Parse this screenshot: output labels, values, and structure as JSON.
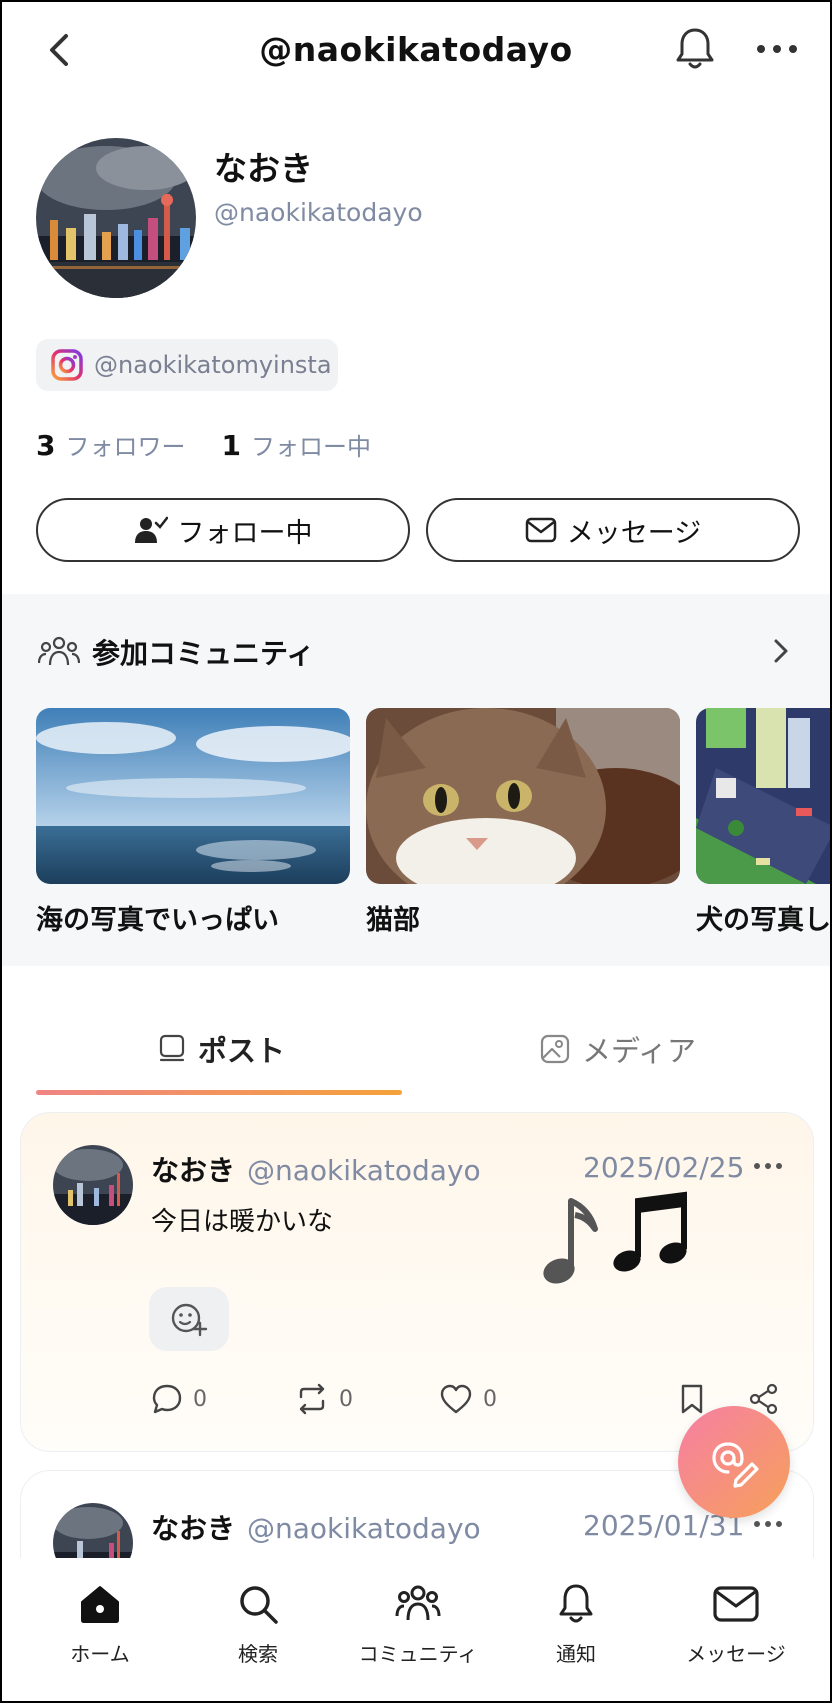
{
  "header": {
    "title": "@naokikatodayo",
    "back_icon": "chevron-left-icon",
    "notify_icon": "bell-icon",
    "more_icon": "more-horizontal-icon"
  },
  "profile": {
    "name": "なおき",
    "handle": "@naokikatodayo",
    "instagram": "@naokikatomyinsta",
    "followers_count": "3",
    "followers_label": "フォロワー",
    "following_count": "1",
    "following_label": "フォロー中",
    "follow_button": "フォロー中",
    "message_button": "メッセージ"
  },
  "communities": {
    "title": "参加コミュニティ",
    "items": [
      {
        "name": "海の写真でいっぱい"
      },
      {
        "name": "猫部"
      },
      {
        "name": "犬の写真し"
      }
    ]
  },
  "tabs": [
    {
      "label": "ポスト",
      "active": true
    },
    {
      "label": "メディア",
      "active": false
    }
  ],
  "posts": [
    {
      "name": "なおき",
      "handle": "@naokikatodayo",
      "date": "2025/02/25",
      "text": "今日は暖かいな",
      "comments": "0",
      "reposts": "0",
      "likes": "0"
    },
    {
      "name": "なおき",
      "handle": "@naokikatodayo",
      "date": "2025/01/31"
    }
  ],
  "nav": [
    {
      "label": "ホーム",
      "icon": "home-icon",
      "active": true
    },
    {
      "label": "検索",
      "icon": "search-icon"
    },
    {
      "label": "コミュニティ",
      "icon": "community-icon"
    },
    {
      "label": "通知",
      "icon": "bell-icon"
    },
    {
      "label": "メッセージ",
      "icon": "mail-icon"
    }
  ],
  "colors": {
    "accent_start": "#ef8585",
    "accent_end": "#f4a23a",
    "muted_text": "#7f8aa3"
  }
}
